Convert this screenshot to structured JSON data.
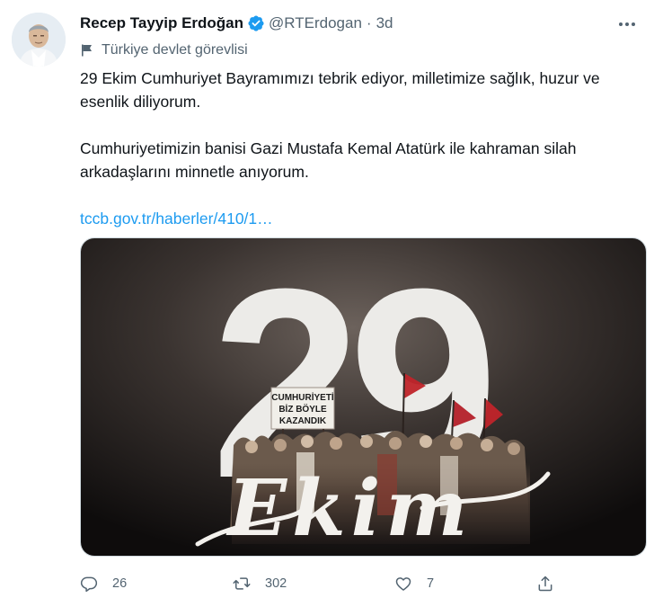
{
  "tweet": {
    "author_name": "Recep Tayyip Erdoğan",
    "handle": "@RTErdogan",
    "separator": "·",
    "time": "3d",
    "label": "Türkiye devlet görevlisi",
    "text": {
      "line1": "29 Ekim Cumhuriyet Bayramımızı tebrik ediyor, milletimize sağlık, huzur ve esenlik diliyorum.",
      "line2": "Cumhuriyetimizin banisi Gazi Mustafa Kemal Atatürk ile kahraman silah arkadaşlarını minnetle anıyorum.",
      "link": "tccb.gov.tr/haberler/410/1…"
    },
    "media": {
      "big_number": "29",
      "banner_line1": "CUMHURİYETİ",
      "banner_line2": "BİZ BÖYLE",
      "banner_line3": "KAZANDIK",
      "script_text": "Ekim"
    },
    "stats": {
      "replies": "26",
      "retweets": "302",
      "likes": "7"
    },
    "icons": {
      "verified": "verified-badge-icon",
      "label": "flag-icon",
      "more": "more-icon",
      "reply": "reply-icon",
      "retweet": "retweet-icon",
      "like": "heart-icon",
      "share": "share-icon"
    },
    "colors": {
      "accent": "#1d9bf0",
      "text": "#0f1419",
      "secondary": "#536471"
    }
  }
}
